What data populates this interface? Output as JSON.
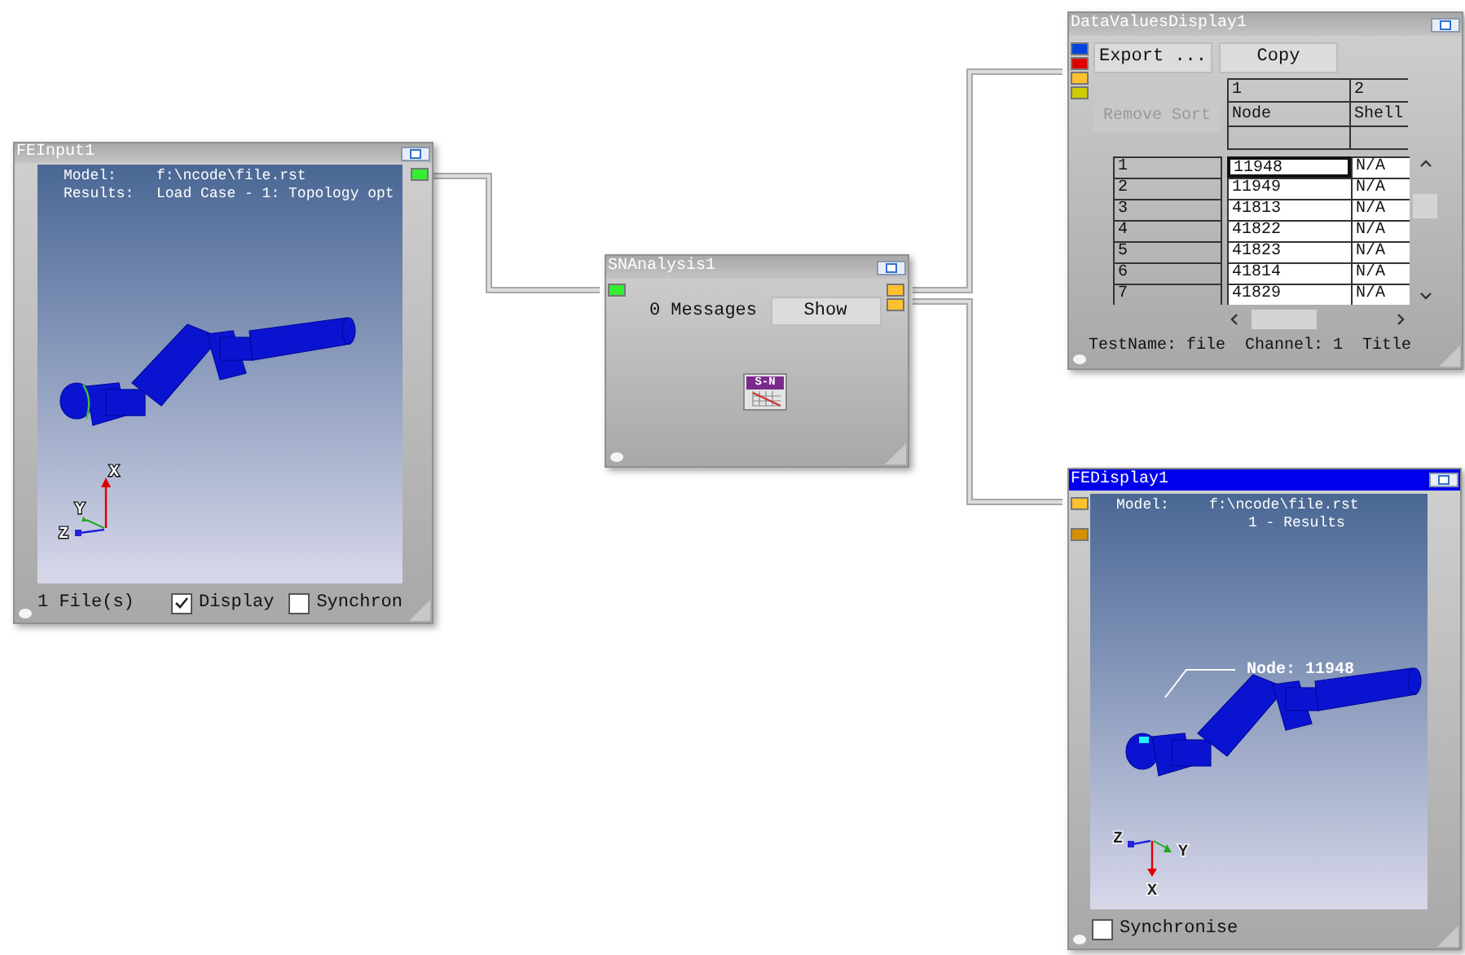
{
  "fe_input": {
    "title": "FEInput1",
    "selected": false,
    "info": [
      {
        "label": "Model:",
        "value": "f:\\ncode\\file.rst"
      },
      {
        "label": "Results:",
        "value": "Load Case - 1: Topology opt"
      }
    ],
    "output_ports": [
      {
        "color": "#33ee33"
      }
    ],
    "axes": [
      "X",
      "Y",
      "Z"
    ],
    "file_count": "1 File(s)",
    "checkboxes": [
      {
        "label": "Display",
        "checked": true
      },
      {
        "label": "Synchron",
        "checked": false
      }
    ]
  },
  "sn_analysis": {
    "title": "SNAnalysis1",
    "selected": false,
    "input_ports": [
      {
        "color": "#33ee33"
      }
    ],
    "output_ports": [
      {
        "color": "#ffc030"
      },
      {
        "color": "#ffc030"
      }
    ],
    "messages": "0 Messages",
    "show_button": "Show",
    "icon_label": "S-N"
  },
  "data_values_display": {
    "title": "DataValuesDisplay1",
    "selected": false,
    "input_ports": [
      {
        "color": "#0044dd"
      },
      {
        "color": "#dd0000"
      },
      {
        "color": "#ffc030"
      },
      {
        "color": "#cccc00"
      }
    ],
    "buttons": [
      {
        "label": "Export ...",
        "disabled": false
      },
      {
        "label": "Copy",
        "disabled": false
      },
      {
        "label": "Remove Sort",
        "disabled": true
      }
    ],
    "columns": [
      {
        "index": "1",
        "name": "Node"
      },
      {
        "index": "2",
        "name": "Shell"
      }
    ],
    "rows": [
      {
        "header": "1",
        "cells": [
          "11948",
          "N/A"
        ],
        "selected": true
      },
      {
        "header": "2",
        "cells": [
          "11949",
          "N/A"
        ],
        "selected": false
      },
      {
        "header": "3",
        "cells": [
          "41813",
          "N/A"
        ],
        "selected": false
      },
      {
        "header": "4",
        "cells": [
          "41822",
          "N/A"
        ],
        "selected": false
      },
      {
        "header": "5",
        "cells": [
          "41823",
          "N/A"
        ],
        "selected": false
      },
      {
        "header": "6",
        "cells": [
          "41814",
          "N/A"
        ],
        "selected": false
      },
      {
        "header": "7",
        "cells": [
          "41829",
          "N/A"
        ],
        "selected": false
      }
    ],
    "status": "TestName: file  Channel: 1  Title"
  },
  "fe_display": {
    "title": "FEDisplay1",
    "selected": true,
    "input_ports": [
      {
        "color": "#ffc030"
      },
      {
        "color": "#d49000"
      }
    ],
    "info": [
      {
        "label": "Model:",
        "value": "f:\\ncode\\file.rst"
      },
      {
        "value": "1 - Results"
      }
    ],
    "node_label": "Node: 11948",
    "axes": [
      "X",
      "Y",
      "Z"
    ],
    "checkboxes": [
      {
        "label": "Synchronise",
        "checked": false
      }
    ]
  }
}
